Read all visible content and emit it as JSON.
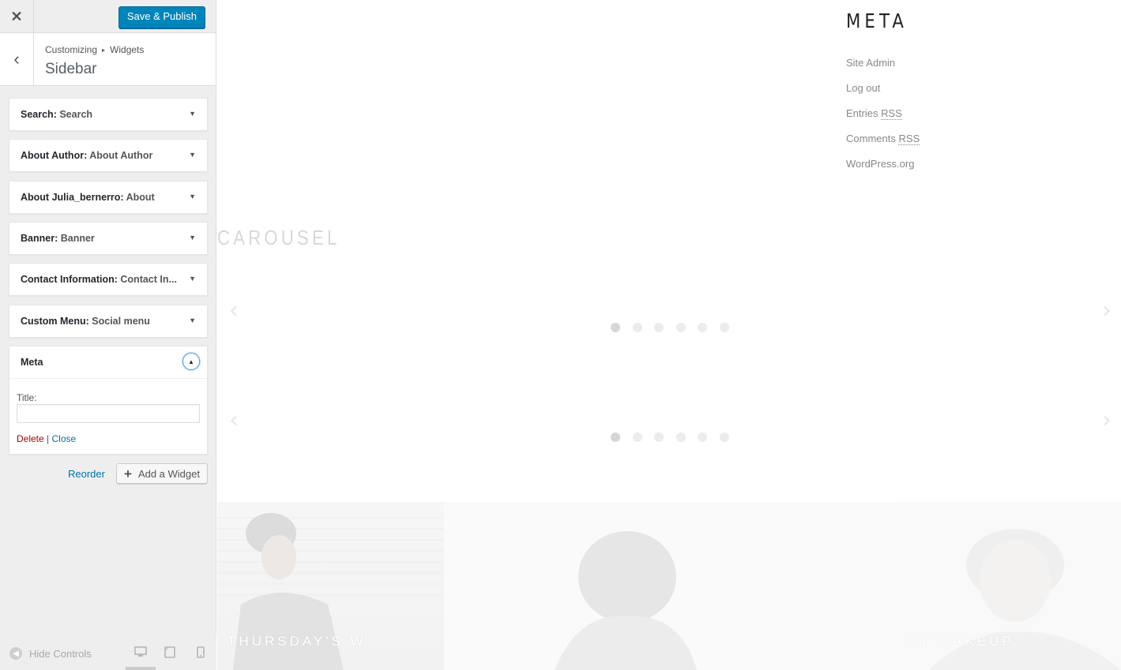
{
  "toolbar": {
    "close_icon": "close-icon",
    "save_label": "Save & Publish"
  },
  "section": {
    "breadcrumb": [
      "Customizing",
      "Widgets"
    ],
    "title": "Sidebar"
  },
  "widgets": [
    {
      "type": "Search",
      "title": "Search"
    },
    {
      "type": "About Author",
      "title": "About Author"
    },
    {
      "type": "About Julia_bernerro",
      "title": "About"
    },
    {
      "type": "Banner",
      "title": "Banner"
    },
    {
      "type": "Contact Information",
      "title": "Contact In..."
    },
    {
      "type": "Custom Menu",
      "title": "Social menu"
    }
  ],
  "open_widget": {
    "type": "Meta",
    "field_label": "Title:",
    "title_value": "",
    "delete_label": "Delete",
    "separator": "|",
    "close_label": "Close"
  },
  "actions": {
    "reorder_label": "Reorder",
    "add_widget_label": "Add a Widget"
  },
  "footer": {
    "hide_controls_label": "Hide Controls",
    "active_device": "desktop"
  },
  "preview": {
    "meta_heading": "META",
    "meta_links": [
      "Site Admin",
      "Log out",
      "Entries",
      "Comments",
      "WordPress.org"
    ],
    "rss_abbr": "RSS",
    "carousel_heading": "CAROUSEL",
    "carousel_dots": 6,
    "active_dot": 0,
    "photo_captions": [
      "THURSDAY'S W",
      "",
      "AY MAKEUP"
    ]
  },
  "colors": {
    "accent": "#0085ba",
    "link": "#0073aa",
    "delete": "#a00"
  }
}
